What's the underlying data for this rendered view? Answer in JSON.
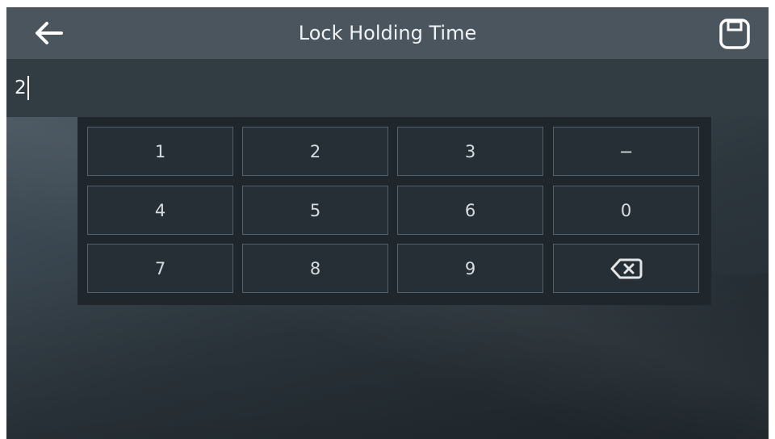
{
  "header": {
    "title": "Lock Holding Time",
    "back_icon": "arrow-left-icon",
    "save_icon": "save-icon"
  },
  "input": {
    "value": "2"
  },
  "keypad": {
    "keys": [
      "1",
      "2",
      "3",
      "−",
      "4",
      "5",
      "6",
      "0",
      "7",
      "8",
      "9"
    ],
    "backspace_icon": "backspace-icon"
  },
  "colors": {
    "topbar": "#4a555e",
    "input_row": "#323c43",
    "keypad_bg": "#1f272d",
    "key_border": "#55616a"
  }
}
